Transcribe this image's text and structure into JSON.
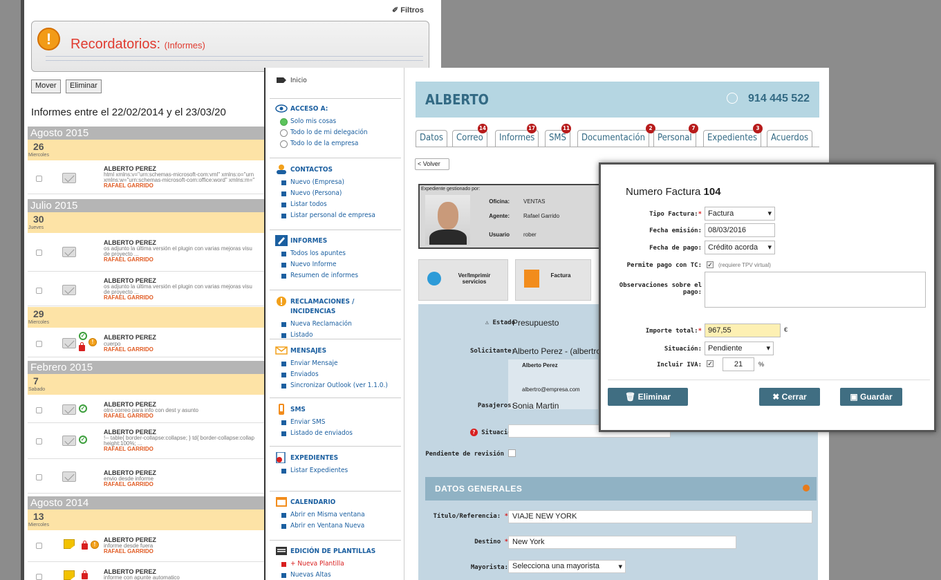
{
  "back": {
    "filtros": "Filtros",
    "recordatorios_title": "Recordatorios:",
    "recordatorios_sub": "(Informes)",
    "btn_mover": "Mover",
    "btn_eliminar": "Eliminar",
    "range": "Informes entre el 22/02/2014 y el 23/03/20",
    "months": [
      "Agosto 2015",
      "Julio 2015",
      "Febrero 2015",
      "Agosto 2014"
    ],
    "days": [
      {
        "n": "26",
        "w": "Miercoles"
      },
      {
        "n": "30",
        "w": "Jueves"
      },
      {
        "n": "29",
        "w": "Miercoles"
      },
      {
        "n": "7",
        "w": "Sabado"
      },
      {
        "n": "13",
        "w": "Miercoles"
      }
    ],
    "rows": [
      {
        "name": "ALBERTO PEREZ",
        "snippet": "html xmlns:v=\"urn:schemas-microsoft-com:vml\" xmlns:o=\"urn",
        "snippet2": "xmlns:w=\"urn:schemas-microsoft-com:office:word\" xmlns:m=\"",
        "agent": "RAFAEL GARRIDO"
      },
      {
        "name": "ALBERTO PEREZ",
        "snippet": "os adjunto la última versión el plugin con varias mejoras visu",
        "snippet2": "de proyecto ...",
        "agent": "RAFAEL GARRIDO"
      },
      {
        "name": "ALBERTO PEREZ",
        "snippet": "os adjunto la última versión el plugin con varias mejoras visu",
        "snippet2": "de proyecto ...",
        "agent": "RAFAEL GARRIDO"
      },
      {
        "name": "ALBERTO PEREZ",
        "snippet": "cuerpo",
        "snippet2": "",
        "agent": "RAFAEL GARRIDO"
      },
      {
        "name": "ALBERTO PEREZ",
        "snippet": "otro correo para info con dest y asunto",
        "snippet2": "",
        "agent": "RAFAEL GARRIDO"
      },
      {
        "name": "ALBERTO PEREZ",
        "snippet": "!-- table{ border-collapse:collapse; } td{ border-collapse:collap",
        "snippet2": "height:100%; ...",
        "agent": "RAFAEL GARRIDO"
      },
      {
        "name": "ALBERTO PEREZ",
        "snippet": "envio desde informe",
        "snippet2": "",
        "agent": "RAFAEL GARRIDO"
      },
      {
        "name": "ALBERTO PEREZ",
        "snippet": "informe desde fuera",
        "snippet2": "",
        "agent": "RAFAEL GARRIDO"
      },
      {
        "name": "ALBERTO PEREZ",
        "snippet": "informe con apunte automatico",
        "snippet2": "",
        "agent": ""
      }
    ]
  },
  "nav": {
    "inicio": "Inicio",
    "acceso": "ACCESO A:",
    "acceso_opts": [
      "Solo mis cosas",
      "Todo lo de mi delegación",
      "Todo lo de la empresa"
    ],
    "contactos": "CONTACTOS",
    "contactos_items": [
      "Nuevo (Empresa)",
      "Nuevo (Persona)",
      "Listar todos",
      "Listar personal de empresa"
    ],
    "informes": "INFORMES",
    "informes_items": [
      "Todos los apuntes",
      "Nuevo Informe",
      "Resumen de informes"
    ],
    "reclamaciones": "RECLAMACIONES / INCIDENCIAS",
    "reclamaciones_items": [
      "Nueva Reclamación",
      "Listado"
    ],
    "mensajes": "MENSAJES",
    "mensajes_items": [
      "Enviar Mensaje",
      "Enviados",
      "Sincronizar Outlook (ver 1.1.0.)"
    ],
    "sms": "SMS",
    "sms_items": [
      "Enviar SMS",
      "Listado de enviados"
    ],
    "expedientes": "EXPEDIENTES",
    "expedientes_items": [
      "Listar Expedientes"
    ],
    "calendario": "CALENDARIO",
    "calendario_items": [
      "Abrir en Misma ventana",
      "Abrir en Ventana Nueva"
    ],
    "plantillas": "EDICIÓN DE PLANTILLAS",
    "plantillas_items": [
      "+ Nueva Plantilla",
      "Nuevas Altas"
    ]
  },
  "main": {
    "name": "ALBERTO",
    "phone": "914 445 522",
    "tabs": [
      {
        "label": "Datos",
        "badge": ""
      },
      {
        "label": "Correo",
        "badge": "14"
      },
      {
        "label": "Informes",
        "badge": "17"
      },
      {
        "label": "SMS",
        "badge": "11"
      },
      {
        "label": "Documentación",
        "badge": "2"
      },
      {
        "label": "Personal",
        "badge": "7"
      },
      {
        "label": "Expedientes",
        "badge": "3"
      },
      {
        "label": "Acuerdos",
        "badge": ""
      }
    ],
    "volver": "< Volver",
    "exp_title": "Expediente gestionado por:",
    "oficina_l": "Oficina:",
    "oficina_v": "VENTAS",
    "agente_l": "Agente:",
    "agente_v": "Rafael Garrido",
    "usuario_l": "Usuario",
    "usuario_v": "rober",
    "ver_imprimir": "Ver/Imprimir servicios",
    "factura": "Factura",
    "estado_l": "Estado",
    "estado_v": "Presupuesto",
    "solicitante_l": "Solicitante:",
    "solicitante_v": "Alberto Perez - (albertro@",
    "sol_name": "Alberto Perez",
    "sol_email": "albertro@empresa.com",
    "pasajeros_l": "Pasajeros:",
    "pasajeros_v": "Sonia Martin",
    "situacion_l": "Situación",
    "pendiente_l": "Pendiente de revisión",
    "datos_generales": "DATOS GENERALES",
    "titulo_l": "Título/Referencia:",
    "titulo_v": "VIAJE NEW YORK",
    "destino_l": "Destino",
    "destino_v": "New York",
    "mayorista_l": "Mayorista:",
    "mayorista_v": "Selecciona una mayorista"
  },
  "modal": {
    "title": "Numero Factura",
    "number": "104",
    "tipo_l": "Tipo Factura:",
    "tipo_v": "Factura",
    "fecha_em_l": "Fecha emisión:",
    "fecha_em_v": "08/03/2016",
    "fecha_pago_l": "Fecha de pago:",
    "fecha_pago_v": "Crédito acorda",
    "permite_l": "Permite pago con TC:",
    "permite_note": "(requiere TPV virtual)",
    "obs_l": "Observaciones sobre el pago:",
    "importe_l": "Importe total:",
    "importe_v": "967,55",
    "currency": "€",
    "situacion_l": "Situación:",
    "situacion_v": "Pendiente",
    "iva_l": "Incluir IVA:",
    "iva_v": "21",
    "pct": "%",
    "eliminar": "Eliminar",
    "cerrar": "✖ Cerrar",
    "guardar": "Guardar"
  }
}
